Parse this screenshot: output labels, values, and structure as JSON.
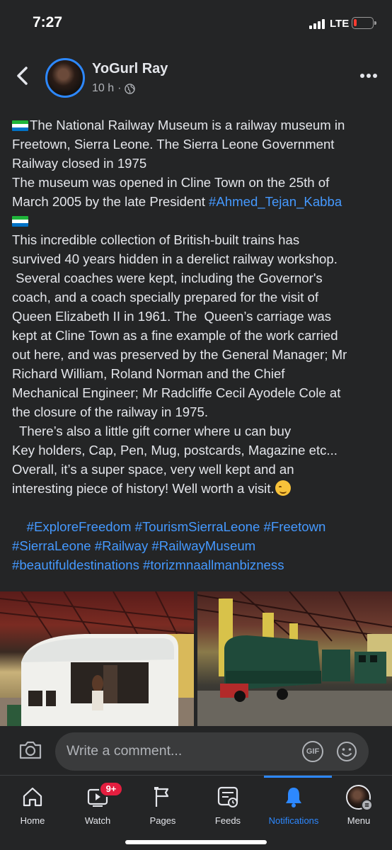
{
  "status_bar": {
    "time": "7:27",
    "network": "LTE"
  },
  "post": {
    "author": "YoGurl Ray",
    "time_ago": "10 h",
    "privacy_icon": "globe-icon",
    "lines": [
      [
        {
          "type": "flag"
        },
        {
          "type": "text",
          "text": "The National Railway Museum is a railway museum in"
        }
      ],
      [
        {
          "type": "text",
          "text": "Freetown, Sierra Leone. The Sierra Leone Government"
        }
      ],
      [
        {
          "type": "text",
          "text": "Railway closed in 1975"
        }
      ],
      [
        {
          "type": "text",
          "text": "The museum was opened in Cline Town on the 25th of"
        }
      ],
      [
        {
          "type": "text",
          "text": "March 2005 by the late President "
        },
        {
          "type": "tag",
          "text": "#Ahmed_Tejan_Kabba"
        }
      ],
      [
        {
          "type": "flag"
        }
      ],
      [
        {
          "type": "text",
          "text": "This incredible collection of British-built trains has"
        }
      ],
      [
        {
          "type": "text",
          "text": "survived 40 years hidden in a derelict railway workshop."
        }
      ],
      [
        {
          "type": "text",
          "text": " Several coaches were kept, including the Governor's"
        }
      ],
      [
        {
          "type": "text",
          "text": "coach, and a coach specially prepared for the visit of"
        }
      ],
      [
        {
          "type": "text",
          "text": "Queen Elizabeth II in 1961. The  Queen’s carriage was"
        }
      ],
      [
        {
          "type": "text",
          "text": "kept at Cline Town as a fine example of the work carried"
        }
      ],
      [
        {
          "type": "text",
          "text": "out here, and was preserved by the General Manager; Mr"
        }
      ],
      [
        {
          "type": "text",
          "text": "Richard William, Roland Norman and the Chief"
        }
      ],
      [
        {
          "type": "text",
          "text": "Mechanical Engineer; Mr Radcliffe Cecil Ayodele Cole at"
        }
      ],
      [
        {
          "type": "text",
          "text": "the closure of the railway in 1975."
        }
      ],
      [
        {
          "type": "text",
          "text": "  There’s also a little gift corner where u can buy"
        }
      ],
      [
        {
          "type": "text",
          "text": "Key holders, Cap, Pen, Mug, postcards, Magazine etc..."
        }
      ],
      [
        {
          "type": "text",
          "text": "Overall, it’s a super space, very well kept and an"
        }
      ],
      [
        {
          "type": "text",
          "text": "interesting piece of history! Well worth a visit."
        },
        {
          "type": "emoji"
        }
      ],
      [],
      [
        {
          "type": "text",
          "text": "    "
        },
        {
          "type": "tag",
          "text": "#ExploreFreedom #TourismSierraLeone #Freetown"
        }
      ],
      [
        {
          "type": "tag",
          "text": "#SierraLeone #Railway #RailwayMuseum"
        }
      ],
      [
        {
          "type": "tag",
          "text": "#beautifuldestinations #torizmnaallmanbizness"
        }
      ]
    ],
    "photos": [
      "photo-railway-coach",
      "photo-locomotives"
    ]
  },
  "comment": {
    "placeholder": "Write a comment...",
    "gif_label": "GIF"
  },
  "nav": {
    "items": [
      {
        "label": "Home",
        "icon": "home-icon"
      },
      {
        "label": "Watch",
        "icon": "watch-icon"
      },
      {
        "label": "Pages",
        "icon": "flag-icon"
      },
      {
        "label": "Feeds",
        "icon": "feeds-icon"
      },
      {
        "label": "Notifications",
        "icon": "bell-icon"
      },
      {
        "label": "Menu",
        "icon": "menu-avatar-icon"
      }
    ],
    "watch_badge": "9+",
    "active": "Notifications"
  },
  "colors": {
    "accent": "#2d88ff",
    "hashtag": "#4599ff",
    "background": "#242526",
    "badge": "#e41e3f"
  }
}
